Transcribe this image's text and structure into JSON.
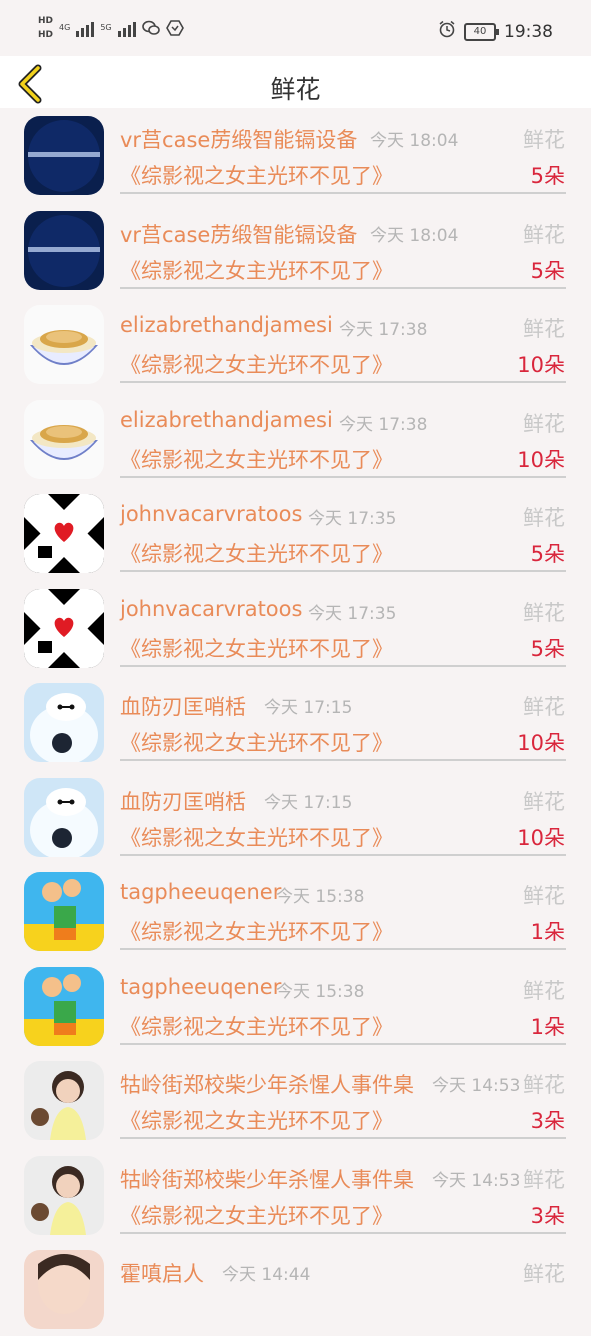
{
  "status_bar": {
    "hd1": "HD",
    "hd2": "HD",
    "net1": "4G",
    "net2": "5G",
    "battery": "40",
    "time": "19:38"
  },
  "header": {
    "title": "鲜花"
  },
  "colors": {
    "accent_orange": "#e98b58",
    "count_red": "#d9263c",
    "back_icon_yellow": "#f2d21c"
  },
  "rows": [
    {
      "name": "vr莒case苈缎智能镉设备",
      "time": "今天 18:04",
      "gift": "鲜花",
      "book": "《综影视之女主光环不见了》",
      "count": "5朵",
      "avatar_icon": "text-banner-avatar"
    },
    {
      "name": "vr莒case苈缎智能镉设备",
      "time": "今天 18:04",
      "gift": "鲜花",
      "book": "《综影视之女主光环不见了》",
      "count": "5朵",
      "avatar_icon": "text-banner-avatar"
    },
    {
      "name": "elizabrethandjamesi",
      "time": "今天 17:38",
      "gift": "鲜花",
      "book": "《综影视之女主光环不见了》",
      "count": "10朵",
      "avatar_icon": "food-bowl-avatar"
    },
    {
      "name": "elizabrethandjamesi",
      "time": "今天 17:38",
      "gift": "鲜花",
      "book": "《综影视之女主光环不见了》",
      "count": "10朵",
      "avatar_icon": "food-bowl-avatar"
    },
    {
      "name": "johnvacarvratoos",
      "time": "今天 17:35",
      "gift": "鲜花",
      "book": "《综影视之女主光环不见了》",
      "count": "5朵",
      "avatar_icon": "heart-skull-avatar"
    },
    {
      "name": "johnvacarvratoos",
      "time": "今天 17:35",
      "gift": "鲜花",
      "book": "《综影视之女主光环不见了》",
      "count": "5朵",
      "avatar_icon": "heart-skull-avatar"
    },
    {
      "name": "血防刃匡哨栝",
      "time": "今天 17:15",
      "gift": "鲜花",
      "book": "《综影视之女主光环不见了》",
      "count": "10朵",
      "avatar_icon": "white-robot-avatar"
    },
    {
      "name": "血防刃匡哨栝",
      "time": "今天 17:15",
      "gift": "鲜花",
      "book": "《综影视之女主光环不见了》",
      "count": "10朵",
      "avatar_icon": "white-robot-avatar"
    },
    {
      "name": "tagpheeuqener",
      "time": "今天 15:38",
      "gift": "鲜花",
      "book": "《综影视之女主光环不见了》",
      "count": "1朵",
      "avatar_icon": "cartoon-kids-avatar"
    },
    {
      "name": "tagpheeuqener",
      "time": "今天 15:38",
      "gift": "鲜花",
      "book": "《综影视之女主光环不见了》",
      "count": "1朵",
      "avatar_icon": "cartoon-kids-avatar"
    },
    {
      "name": "牯岭街郑校柴少年杀惺人事件臬",
      "time": "今天 14:53",
      "gift": "鲜花",
      "book": "《综影视之女主光环不见了》",
      "count": "3朵",
      "avatar_icon": "child-photo-avatar"
    },
    {
      "name": "牯岭街郑校柴少年杀惺人事件臬",
      "time": "今天 14:53",
      "gift": "鲜花",
      "book": "《综影视之女主光环不见了》",
      "count": "3朵",
      "avatar_icon": "child-photo-avatar"
    },
    {
      "name": "霍嗔启人",
      "time": "今天 14:44",
      "gift": "鲜花",
      "book": "",
      "count": "",
      "avatar_icon": "face-photo-avatar"
    }
  ]
}
